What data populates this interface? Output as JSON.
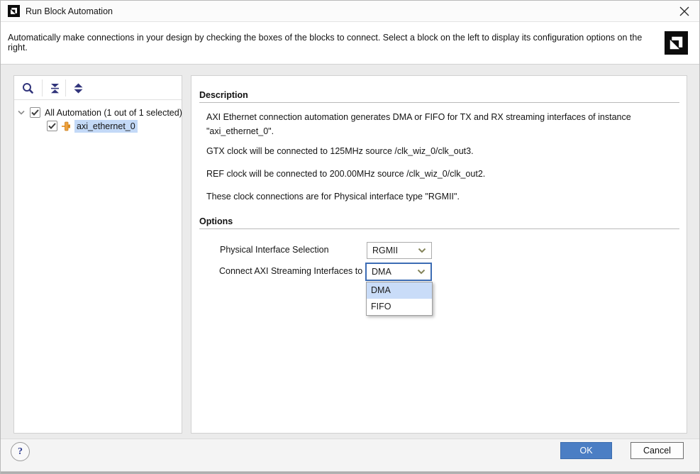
{
  "window": {
    "title": "Run Block Automation",
    "close_glyph": "×"
  },
  "header": {
    "instruction": "Automatically make connections in your design by checking the boxes of the blocks to connect. Select a block on the left to display its configuration options on the right.",
    "logo_icon": "amd-xilinx-logo"
  },
  "left_panel": {
    "toolbar": {
      "search_icon": "search-icon",
      "collapse_icon": "collapse-all-icon",
      "expand_icon": "expand-all-icon"
    },
    "tree": {
      "root": {
        "label": "All Automation (1 out of 1 selected)",
        "checked": true,
        "expanded": true
      },
      "child": {
        "label": "axi_ethernet_0",
        "checked": true,
        "selected": true,
        "icon": "ip-block-icon"
      }
    }
  },
  "description": {
    "heading": "Description",
    "paragraphs": [
      "AXI Ethernet connection automation generates DMA or FIFO for TX and RX streaming interfaces of instance \"axi_ethernet_0\".",
      "GTX clock will be connected to 125MHz source /clk_wiz_0/clk_out3.",
      "REF clock will be connected to 200.00MHz source /clk_wiz_0/clk_out2.",
      "These clock connections are for Physical interface type \"RGMII\"."
    ]
  },
  "options": {
    "heading": "Options",
    "rows": [
      {
        "label": "Physical Interface Selection",
        "value": "RGMII"
      },
      {
        "label": "Connect AXI Streaming Interfaces to",
        "value": "DMA"
      }
    ],
    "open_dropdown": {
      "items": [
        "DMA",
        "FIFO"
      ],
      "highlighted": "DMA"
    }
  },
  "footer": {
    "help_label": "?",
    "ok_label": "OK",
    "cancel_label": "Cancel"
  },
  "colors": {
    "accent_blue": "#4b7ec4",
    "focus_border_blue": "#3c6cb4",
    "selection_highlight": "#c3d9f7",
    "popup_highlight": "#c9dcf8",
    "toolbar_icon_navy": "#31347b",
    "combo_chevron_olive": "#84845a",
    "ip_icon_orange": "#efa23c"
  }
}
